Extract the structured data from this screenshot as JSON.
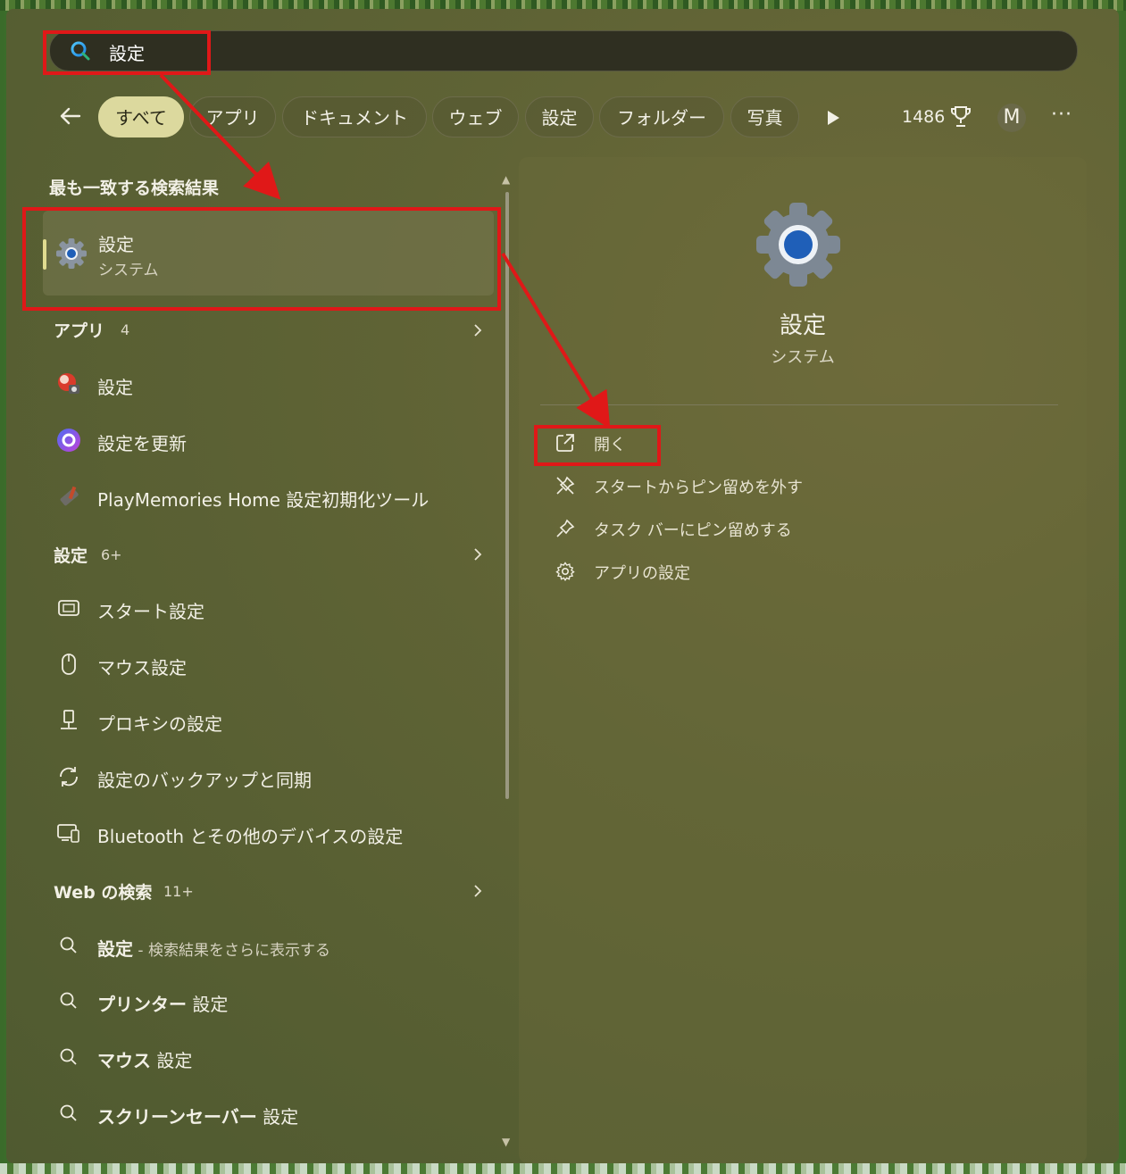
{
  "search": {
    "query": "設定"
  },
  "filters": {
    "back_label": "←",
    "chips": [
      "すべて",
      "アプリ",
      "ドキュメント",
      "ウェブ",
      "設定",
      "フォルダー",
      "写真"
    ],
    "active_index": 0,
    "points": "1486",
    "avatar_letter": "M",
    "more": "···"
  },
  "best_match": {
    "heading": "最も一致する検索結果",
    "title": "設定",
    "subtitle": "システム"
  },
  "apps": {
    "heading": "アプリ",
    "count": "4",
    "items": [
      "設定",
      "設定を更新",
      "PlayMemories Home 設定初期化ツール"
    ]
  },
  "settings": {
    "heading": "設定",
    "count": "6+",
    "items": [
      "スタート設定",
      "マウス設定",
      "プロキシの設定",
      "設定のバックアップと同期",
      "Bluetooth とその他のデバイスの設定"
    ]
  },
  "web": {
    "heading": "Web の検索",
    "count": "11+",
    "items": [
      {
        "bold": "設定",
        "rest": " - 検索結果をさらに表示する"
      },
      {
        "bold": "プリンター",
        "rest": " 設定"
      },
      {
        "bold": "マウス",
        "rest": " 設定"
      },
      {
        "bold": "スクリーンセーバー",
        "rest": " 設定"
      }
    ]
  },
  "detail": {
    "title": "設定",
    "subtitle": "システム",
    "actions": [
      "開く",
      "スタートからピン留めを外す",
      "タスク バーにピン留めする",
      "アプリの設定"
    ]
  },
  "colors": {
    "annotation_red": "#e01818",
    "active_chip": "#dcd99e",
    "gear_blue": "#1f5fb8"
  }
}
